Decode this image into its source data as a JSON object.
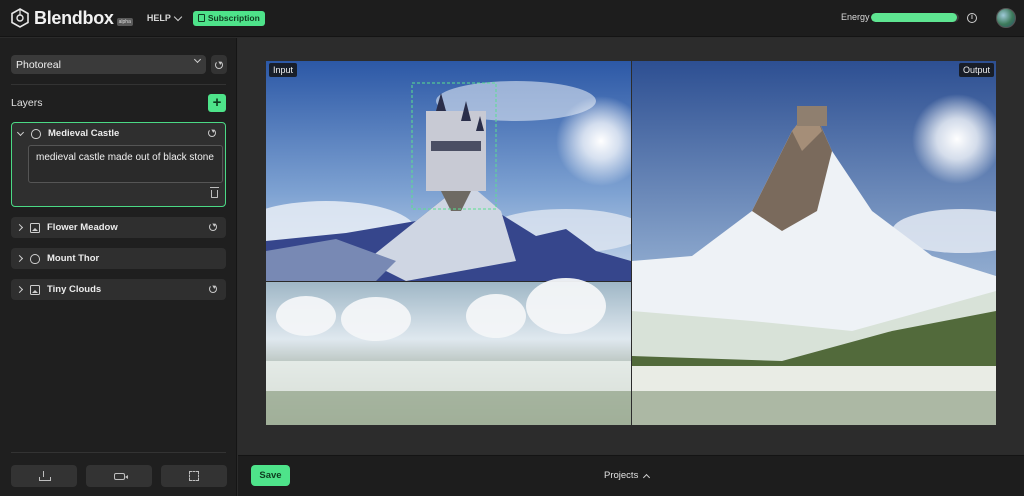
{
  "app": {
    "name": "Blendbox",
    "badge": "alpha",
    "help_label": "HELP",
    "subscription_label": "Subscription",
    "energy_label": "Energy",
    "energy_level": 0.98,
    "accent_color": "#4ee38a"
  },
  "sidebar": {
    "model_select": "Photoreal",
    "layers_title": "Layers",
    "layers": [
      {
        "label": "Medieval Castle",
        "icon": "hand-icon",
        "expanded": true,
        "prompt": "medieval castle made out of black stone"
      },
      {
        "label": "Flower Meadow",
        "icon": "image-icon",
        "expanded": false
      },
      {
        "label": "Mount Thor",
        "icon": "hand-icon",
        "expanded": false
      },
      {
        "label": "Tiny Clouds",
        "icon": "image-icon",
        "expanded": false
      }
    ]
  },
  "canvas": {
    "input_label": "Input",
    "output_label": "Output"
  },
  "footer": {
    "save_label": "Save",
    "projects_label": "Projects"
  }
}
